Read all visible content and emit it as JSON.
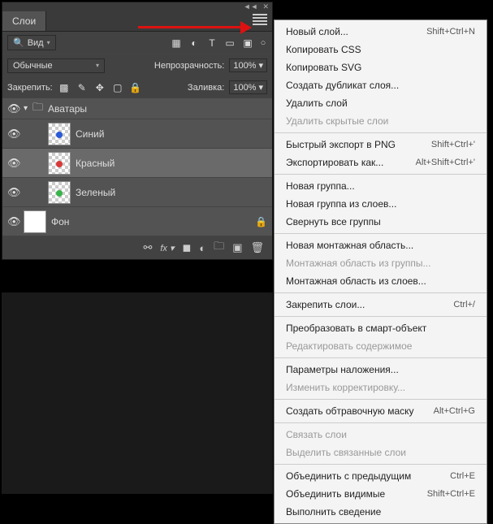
{
  "panel": {
    "tab": "Слои",
    "search_mode": "Вид",
    "blend_mode": "Обычные",
    "opacity_label": "Непрозрачность:",
    "opacity_value": "100%",
    "lock_label": "Закрепить:",
    "fill_label": "Заливка:",
    "fill_value": "100%"
  },
  "layers": {
    "group": "Аватары",
    "items": [
      {
        "name": "Синий",
        "color": "#2a5ad8"
      },
      {
        "name": "Красный",
        "color": "#d83a3a"
      },
      {
        "name": "Зеленый",
        "color": "#3ab44a"
      }
    ],
    "bg": "Фон"
  },
  "menu": {
    "sections": [
      [
        {
          "label": "Новый слой...",
          "shortcut": "Shift+Ctrl+N",
          "enabled": true
        },
        {
          "label": "Копировать CSS",
          "shortcut": "",
          "enabled": true
        },
        {
          "label": "Копировать SVG",
          "shortcut": "",
          "enabled": true
        },
        {
          "label": "Создать дубликат слоя...",
          "shortcut": "",
          "enabled": true
        },
        {
          "label": "Удалить слой",
          "shortcut": "",
          "enabled": true
        },
        {
          "label": "Удалить скрытые слои",
          "shortcut": "",
          "enabled": false
        }
      ],
      [
        {
          "label": "Быстрый экспорт в PNG",
          "shortcut": "Shift+Ctrl+'",
          "enabled": true
        },
        {
          "label": "Экспортировать как...",
          "shortcut": "Alt+Shift+Ctrl+'",
          "enabled": true
        }
      ],
      [
        {
          "label": "Новая группа...",
          "shortcut": "",
          "enabled": true
        },
        {
          "label": "Новая группа из слоев...",
          "shortcut": "",
          "enabled": true
        },
        {
          "label": "Свернуть все группы",
          "shortcut": "",
          "enabled": true
        }
      ],
      [
        {
          "label": "Новая монтажная область...",
          "shortcut": "",
          "enabled": true
        },
        {
          "label": "Монтажная область из группы...",
          "shortcut": "",
          "enabled": false
        },
        {
          "label": "Монтажная область из слоев...",
          "shortcut": "",
          "enabled": true
        }
      ],
      [
        {
          "label": "Закрепить слои...",
          "shortcut": "Ctrl+/",
          "enabled": true
        }
      ],
      [
        {
          "label": "Преобразовать в смарт-объект",
          "shortcut": "",
          "enabled": true
        },
        {
          "label": "Редактировать содержимое",
          "shortcut": "",
          "enabled": false
        }
      ],
      [
        {
          "label": "Параметры наложения...",
          "shortcut": "",
          "enabled": true
        },
        {
          "label": "Изменить корректировку...",
          "shortcut": "",
          "enabled": false
        }
      ],
      [
        {
          "label": "Создать обтравочную маску",
          "shortcut": "Alt+Ctrl+G",
          "enabled": true
        }
      ],
      [
        {
          "label": "Связать слои",
          "shortcut": "",
          "enabled": false
        },
        {
          "label": "Выделить связанные слои",
          "shortcut": "",
          "enabled": false
        }
      ],
      [
        {
          "label": "Объединить с предыдущим",
          "shortcut": "Ctrl+E",
          "enabled": true
        },
        {
          "label": "Объединить видимые",
          "shortcut": "Shift+Ctrl+E",
          "enabled": true
        },
        {
          "label": "Выполнить сведение",
          "shortcut": "",
          "enabled": true
        }
      ]
    ]
  }
}
